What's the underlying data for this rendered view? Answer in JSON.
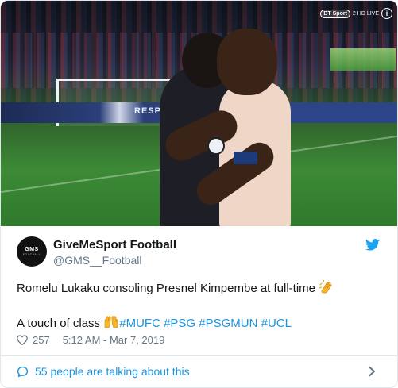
{
  "media": {
    "broadcaster": "BT Sport",
    "channel": "2 HD LIVE",
    "info_glyph": "i",
    "adboard_text": "RESPECT",
    "icons": [
      "ucl-starball-icon",
      "info-icon"
    ]
  },
  "author": {
    "avatar_line1": "GMS",
    "avatar_line2": "FOOTBALL",
    "name": "GiveMeSport Football",
    "handle": "@GMS__Football"
  },
  "tweet": {
    "line1": "Romelu Lukaku consoling Presnel Kimpembe at full-time",
    "line2": "A touch of class",
    "hashtags": [
      "#MUFC",
      "#PSG",
      "#PSGMUN",
      "#UCL"
    ]
  },
  "meta": {
    "likes": "257",
    "timestamp": "5:12 AM - Mar 7, 2019"
  },
  "footer": {
    "talking": "55 people are talking about this"
  },
  "colors": {
    "link": "#1b95e0",
    "muted": "#657786",
    "text": "#14171a",
    "border": "#e1e8ed"
  }
}
